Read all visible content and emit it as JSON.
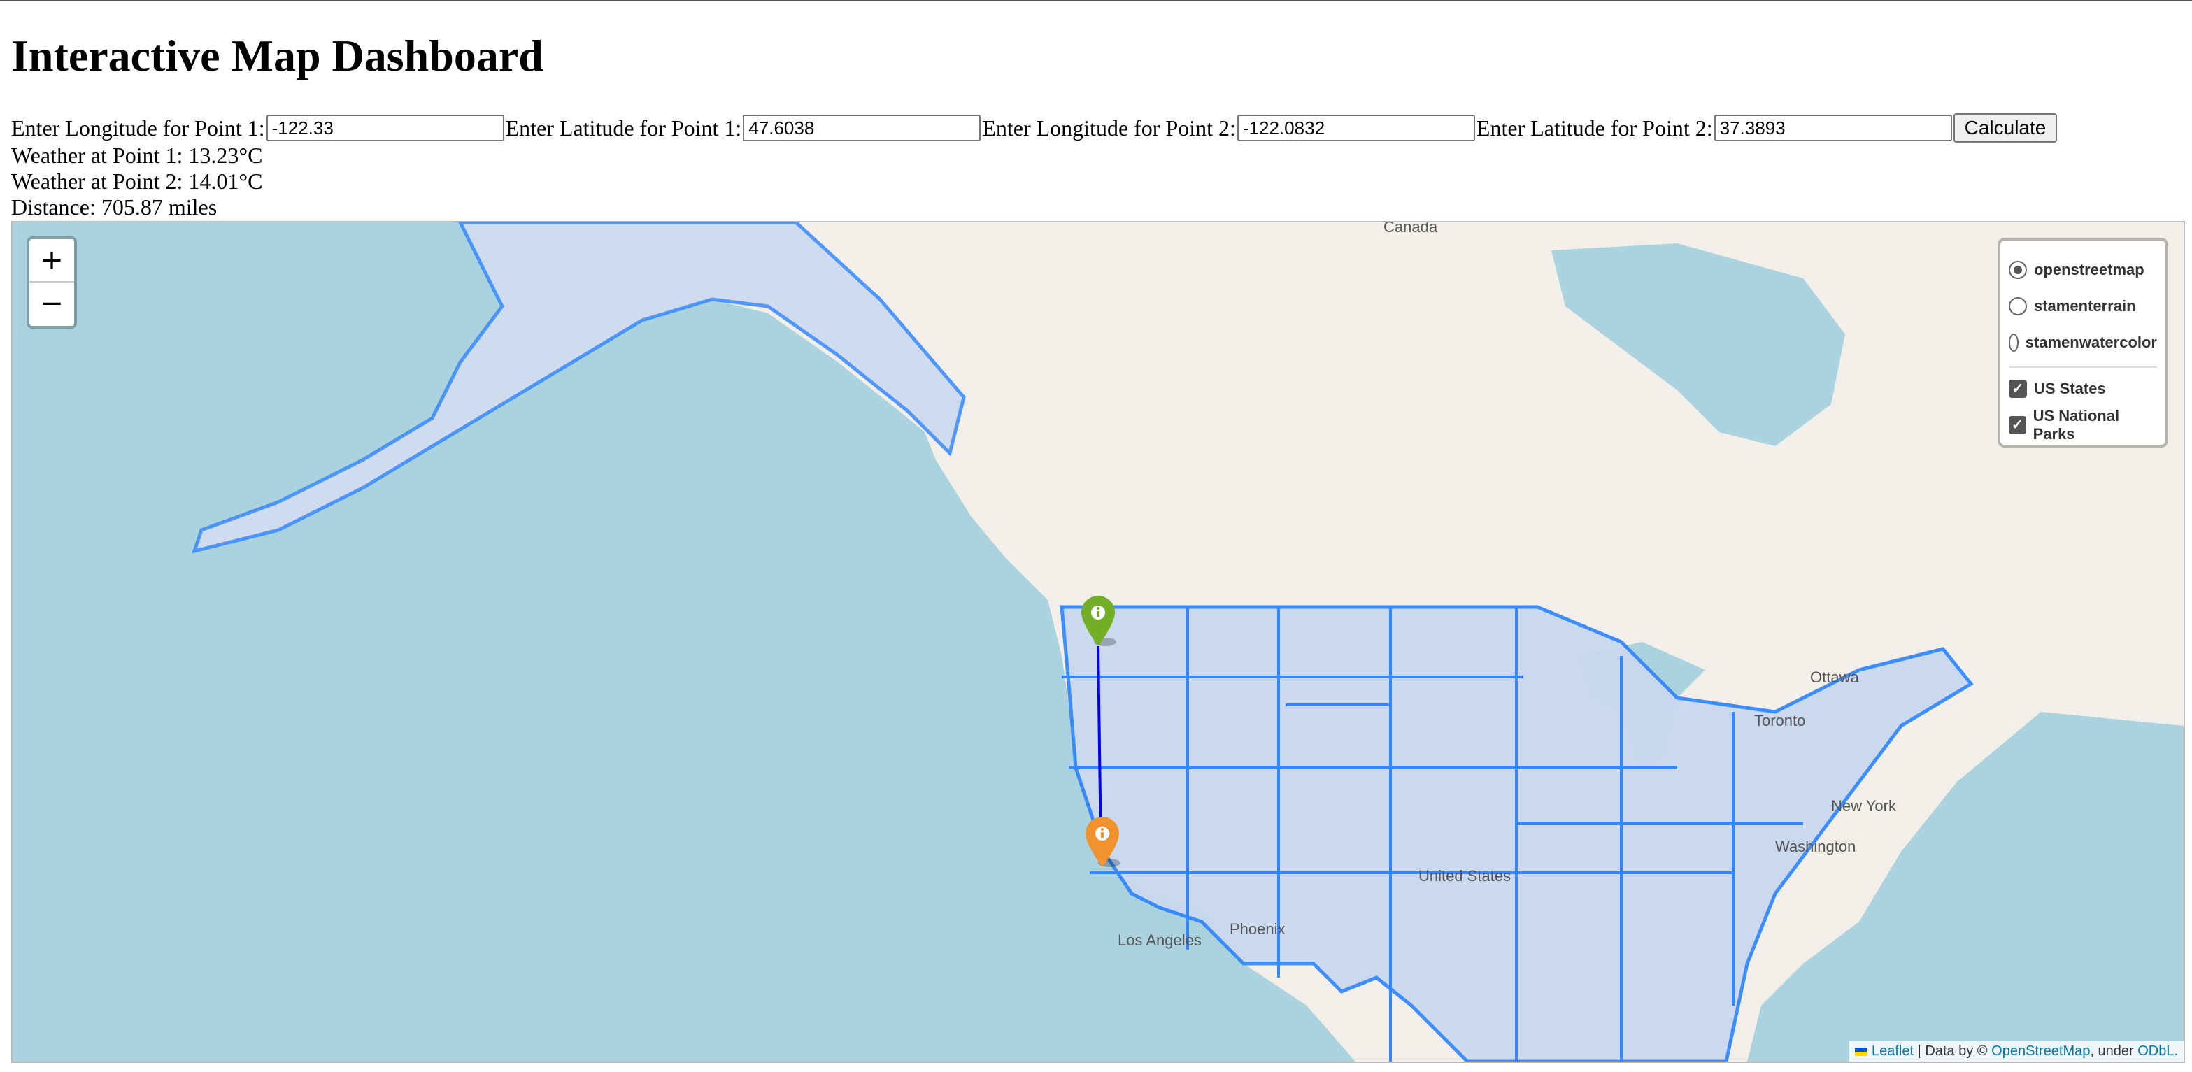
{
  "page": {
    "title": "Interactive Map Dashboard"
  },
  "form": {
    "lon1_label": "Enter Longitude for Point 1:",
    "lon1_value": "-122.33",
    "lat1_label": "Enter Latitude for Point 1:",
    "lat1_value": "47.6038",
    "lon2_label": "Enter Longitude for Point 2:",
    "lon2_value": "-122.0832",
    "lat2_label": "Enter Latitude for Point 2:",
    "lat2_value": "37.3893",
    "calculate_label": "Calculate"
  },
  "results": {
    "weather1": "Weather at Point 1: 13.23°C",
    "weather2": "Weather at Point 2: 14.01°C",
    "distance": "Distance: 705.87 miles"
  },
  "map": {
    "zoom_in": "+",
    "zoom_out": "−",
    "base_layers": [
      {
        "label": "openstreetmap",
        "selected": true
      },
      {
        "label": "stamenterrain",
        "selected": false
      },
      {
        "label": "stamenwatercolor",
        "selected": false
      }
    ],
    "overlays": [
      {
        "label": "US States",
        "checked": true
      },
      {
        "label": "US National Parks",
        "checked": true
      }
    ],
    "place_labels": {
      "canada": "Canada",
      "ottawa": "Ottawa",
      "toronto": "Toronto",
      "new_york": "New York",
      "washington": "Washington",
      "united_states": "United States",
      "phoenix": "Phoenix",
      "los_angeles": "Los Angeles"
    },
    "markers": [
      {
        "name": "point-1",
        "color": "#72af26",
        "lat": 47.6038,
        "lon": -122.33
      },
      {
        "name": "point-2",
        "color": "#f0932f",
        "lat": 37.3893,
        "lon": -122.0832
      }
    ],
    "route_color": "#0000ff",
    "attribution": {
      "leaflet": "Leaflet",
      "data_by": " | Data by © ",
      "osm": "OpenStreetMap",
      "under": ", under ",
      "odbl": "ODbL."
    },
    "colors": {
      "water": "#aad3df",
      "land": "#f2efe9",
      "state_fill": "#c9d8ef",
      "state_line": "#3388ff"
    }
  }
}
